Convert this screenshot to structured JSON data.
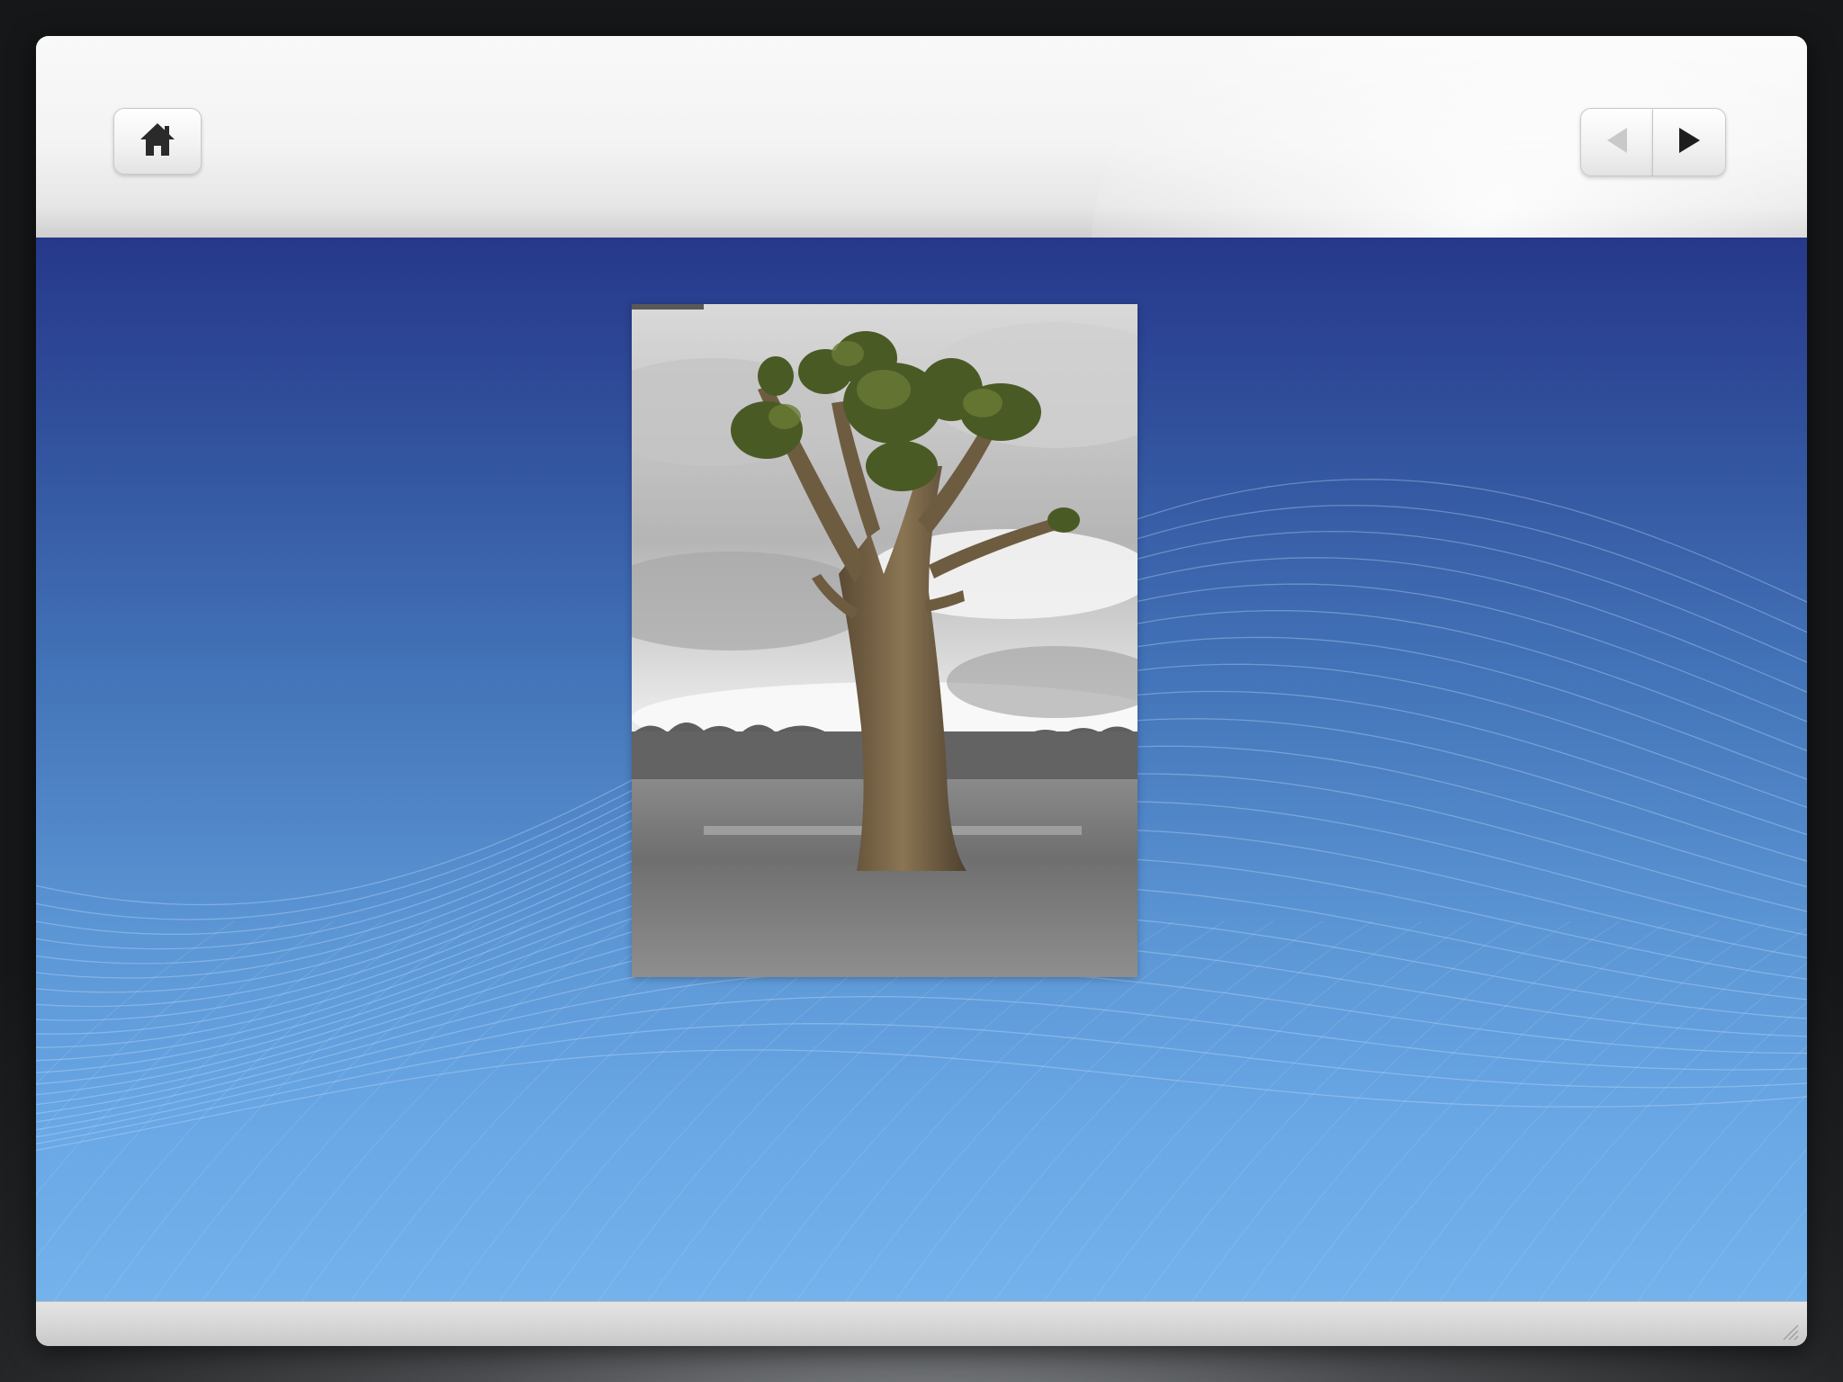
{
  "window": {
    "accent_color": "#2a3c8c",
    "content_gradient_bottom": "#74b2ec"
  },
  "toolbar": {
    "home_icon": "home-icon",
    "prev_icon": "previous-arrow-icon",
    "next_icon": "next-arrow-icon",
    "prev_enabled": false,
    "next_enabled": true
  },
  "slide": {
    "image_subject": "tree-photo"
  },
  "statusbar": {
    "grip_icon": "resize-grip-icon"
  }
}
